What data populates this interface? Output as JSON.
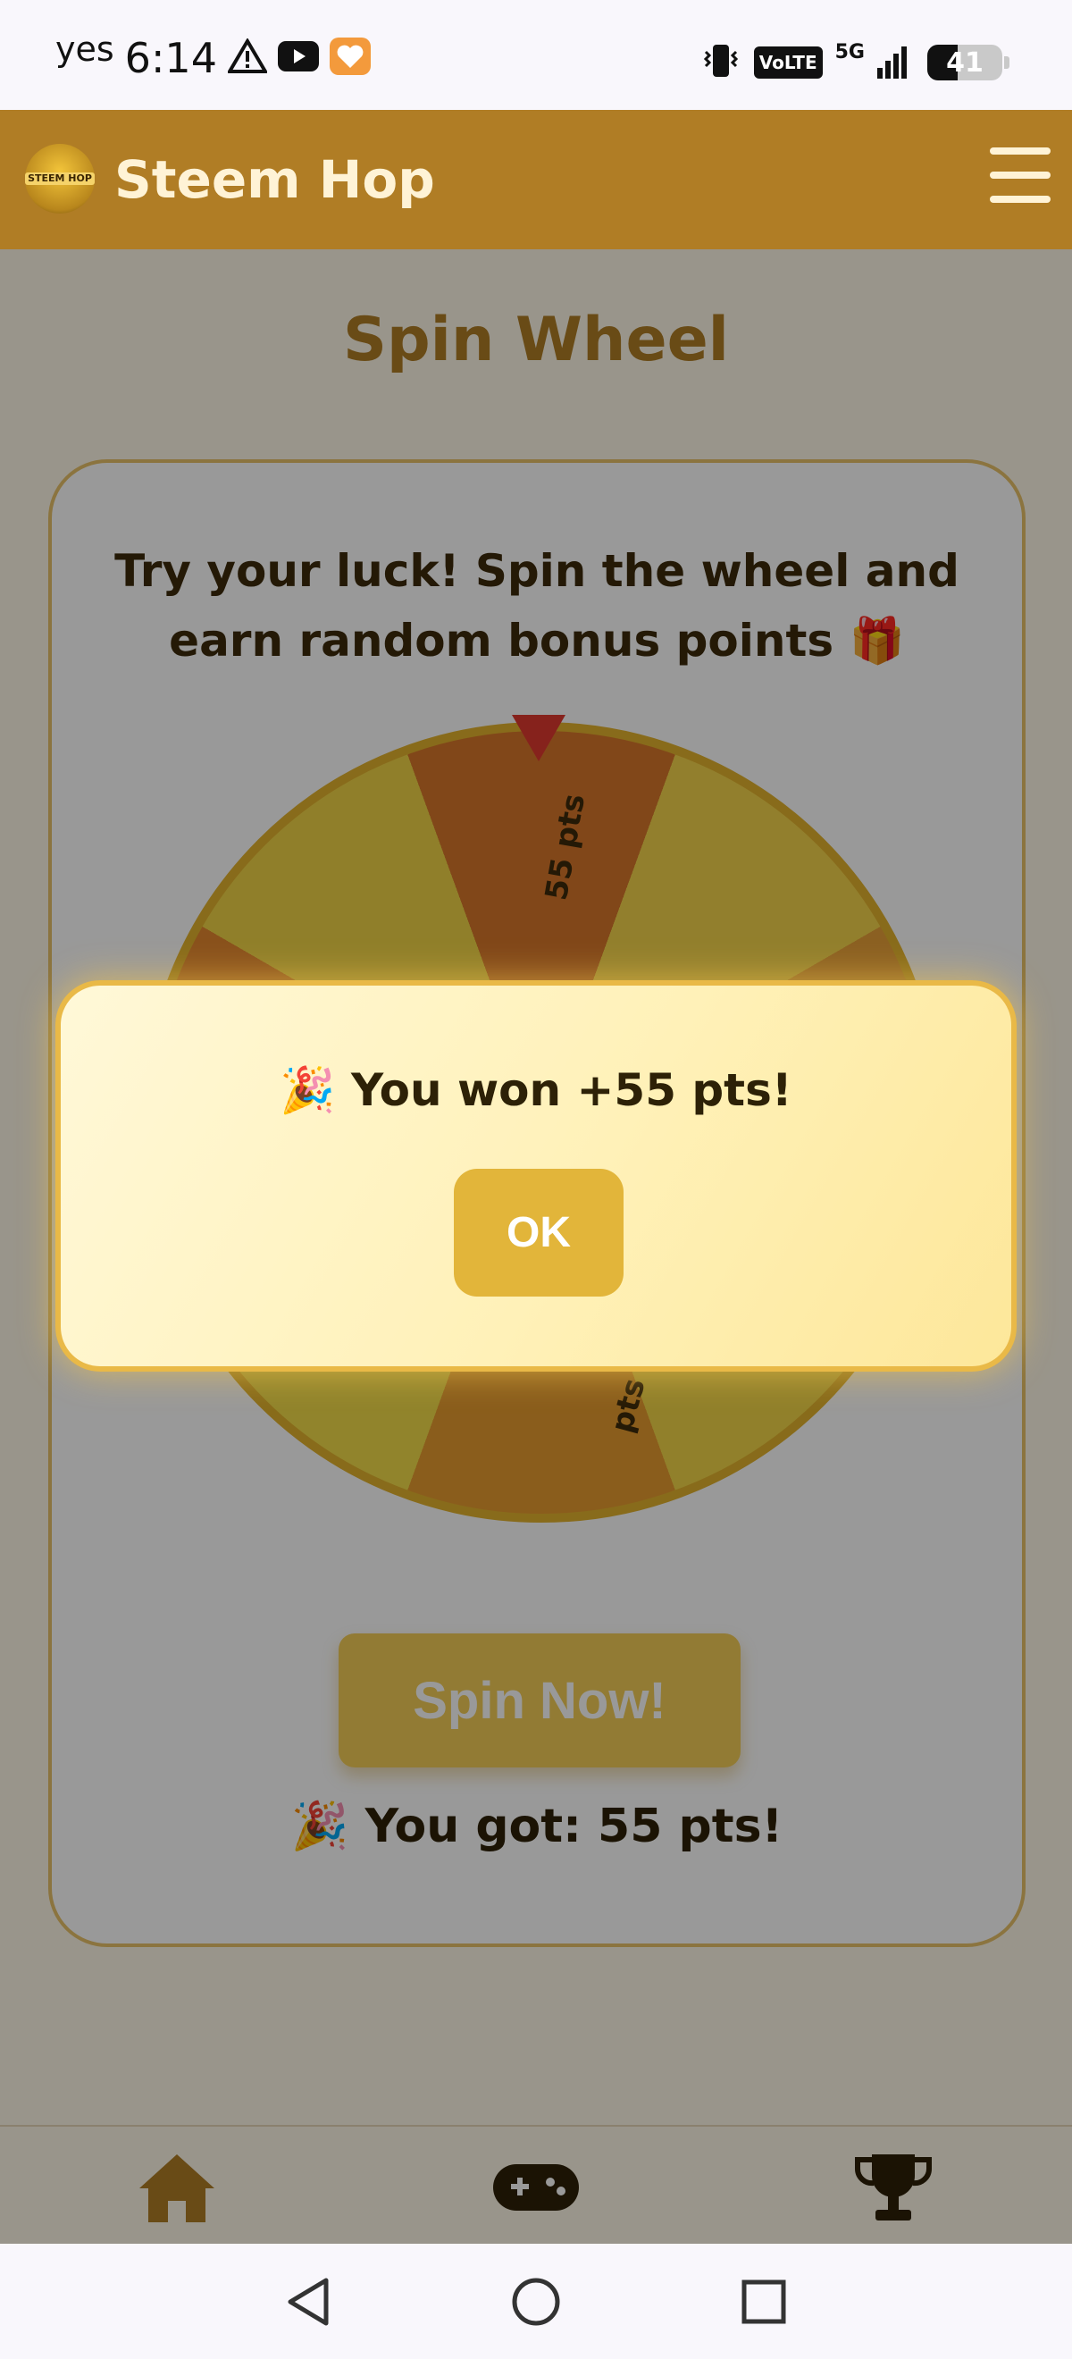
{
  "status_bar": {
    "carrier": "yes",
    "time": "6:14",
    "volte": "VoLTE",
    "network": "5G",
    "battery": "41",
    "battery_level_percent": 41
  },
  "header": {
    "logo_text": "STEEM HOP",
    "title": "Steem Hop",
    "menu_icon": "hamburger-menu-icon"
  },
  "page": {
    "title": "Spin Wheel",
    "intro_text": "Try your luck! Spin the wheel and earn random bonus points 🎁",
    "wheel_labels": [
      "55 pts",
      "pts"
    ],
    "spin_button_label": "Spin Now!",
    "result_text": "🎉 You got: 55 pts!"
  },
  "modal": {
    "message": "🎉 You won +55 pts!",
    "ok_label": "OK"
  },
  "bottom_nav": {
    "items": [
      {
        "name": "home",
        "icon": "home-icon"
      },
      {
        "name": "games",
        "icon": "gamepad-icon"
      },
      {
        "name": "leaderboard",
        "icon": "trophy-icon"
      }
    ]
  },
  "colors": {
    "brand": "#b07d25",
    "accent": "#e2b53a",
    "text_dark": "#2d2107"
  }
}
